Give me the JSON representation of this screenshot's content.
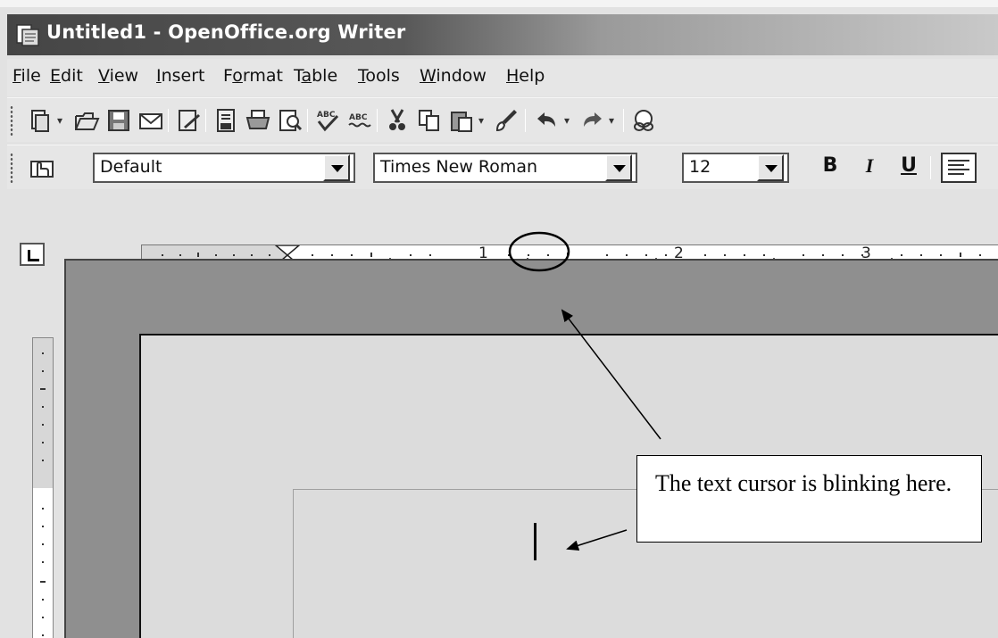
{
  "window": {
    "title": "Untitled1 - OpenOffice.org Writer"
  },
  "menu": [
    {
      "label": "File",
      "accel": "F",
      "rest": "ile"
    },
    {
      "label": "Edit",
      "accel": "E",
      "rest": "dit"
    },
    {
      "label": "View",
      "accel": "V",
      "rest": "iew"
    },
    {
      "label": "Insert",
      "accel": "I",
      "rest": "nsert"
    },
    {
      "label": "Format",
      "pre": "F",
      "accel": "o",
      "rest": "rmat"
    },
    {
      "label": "Table",
      "pre": "T",
      "accel": "a",
      "rest": "ble"
    },
    {
      "label": "Tools",
      "accel": "T",
      "rest": "ools"
    },
    {
      "label": "Window",
      "accel": "W",
      "rest": "indow"
    },
    {
      "label": "Help",
      "accel": "H",
      "rest": "elp"
    }
  ],
  "formatting": {
    "paragraph_style": "Default",
    "font_name": "Times New Roman",
    "font_size": "12",
    "bold": "B",
    "italic": "I",
    "underline": "U"
  },
  "ruler": {
    "labels": [
      "1",
      "2",
      "3"
    ]
  },
  "callout": {
    "text": "The text cursor is blinking here."
  }
}
